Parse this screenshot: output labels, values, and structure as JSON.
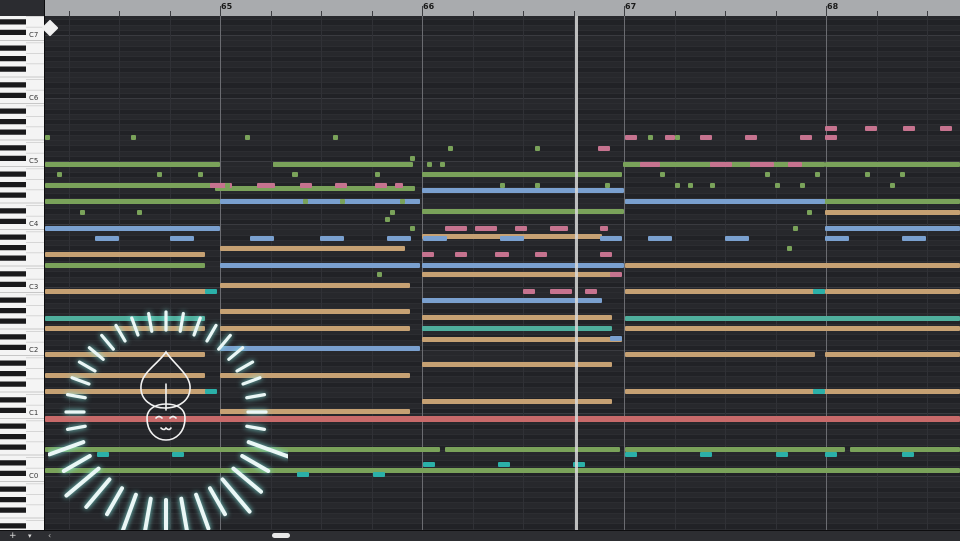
{
  "ruler": {
    "bars": [
      "65",
      "66",
      "67",
      "68"
    ]
  },
  "piano": {
    "octave_labels": [
      "C7",
      "C6",
      "C5",
      "C4",
      "C3",
      "C2",
      "C1",
      "C0"
    ]
  },
  "toolbar": {
    "zoom_in_label": "+",
    "menu_label": "▾",
    "scroll_left_label": "‹"
  },
  "colors": {
    "green": "#7aa25a",
    "blue": "#7aa0cf",
    "tan": "#c6a173",
    "pink": "#c6738f",
    "teal": "#4fae9c",
    "cyan": "#2bb0a8",
    "red": "#c86a6a",
    "grid_bg": "#25262a"
  },
  "icons": {
    "start_marker": "diamond-marker-icon",
    "mascot": "flame-mascot-icon"
  }
}
